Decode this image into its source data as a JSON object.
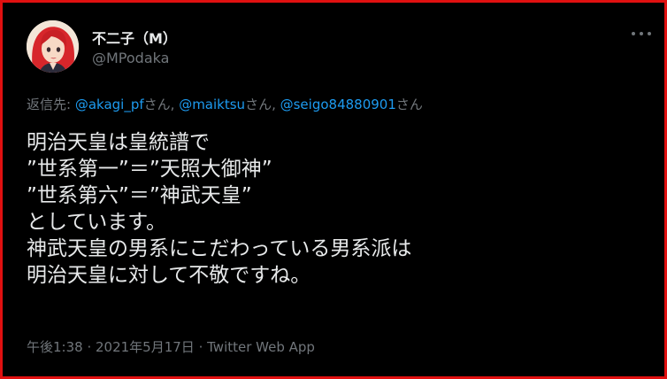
{
  "author": {
    "display_name": "不二子（M）",
    "handle": "@MPodaka"
  },
  "reply": {
    "prefix": "返信先: ",
    "mentions": [
      {
        "handle": "@akagi_pf",
        "suffix": "さん, "
      },
      {
        "handle": "@maiktsu",
        "suffix": "さん, "
      },
      {
        "handle": "@seigo84880901",
        "suffix": "さん"
      }
    ]
  },
  "tweet": {
    "lines": [
      "明治天皇は皇統譜で",
      "”世系第一”＝”天照大御神”",
      "”世系第六”＝”神武天皇”",
      "としています。",
      "神武天皇の男系にこだわっている男系派は",
      "明治天皇に対して不敬ですね。"
    ]
  },
  "meta": {
    "time": "午後1:38",
    "separator1": " · ",
    "date": "2021年5月17日",
    "separator2": " · ",
    "source": "Twitter Web App"
  },
  "icons": {
    "avatar": "avatar-illustration",
    "more": "more-options-icon"
  },
  "colors": {
    "background": "#000000",
    "frame_border": "#e01010",
    "primary_text": "#e7e9ea",
    "secondary_text": "#71767b",
    "link": "#1d9bf0"
  }
}
